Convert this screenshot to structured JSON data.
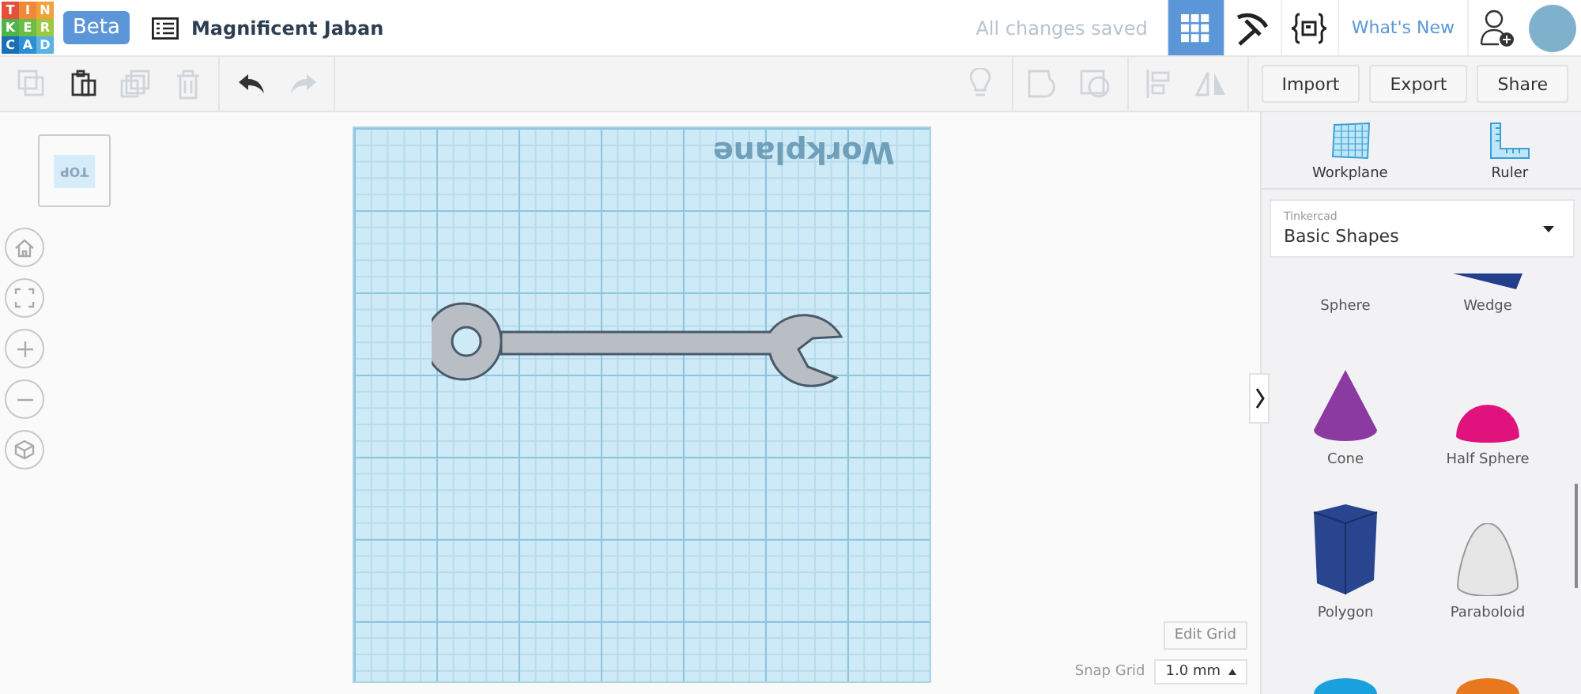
{
  "header": {
    "logo": [
      {
        "letter": "T",
        "color": "#e5503c"
      },
      {
        "letter": "I",
        "color": "#f0883a"
      },
      {
        "letter": "N",
        "color": "#f2a13c"
      },
      {
        "letter": "K",
        "color": "#4fb34a"
      },
      {
        "letter": "E",
        "color": "#6cbd45"
      },
      {
        "letter": "R",
        "color": "#9cc93d"
      },
      {
        "letter": "C",
        "color": "#1b6fb5"
      },
      {
        "letter": "A",
        "color": "#2d8fd4"
      },
      {
        "letter": "D",
        "color": "#5ab4e3"
      }
    ],
    "badge": "Beta",
    "title": "Magnificent Jaban",
    "save_status": "All changes saved",
    "nav": [
      {
        "kind": "grid",
        "selected": true
      },
      {
        "kind": "pickaxe",
        "selected": false
      },
      {
        "kind": "code",
        "selected": false
      }
    ],
    "whats_new": "What's New"
  },
  "toolbar": {
    "tools": [
      {
        "kind": "copy",
        "disabled": true
      },
      {
        "kind": "paste",
        "disabled": false
      },
      {
        "kind": "duplicate",
        "disabled": true
      },
      {
        "kind": "delete",
        "disabled": true
      },
      {
        "kind": "undo",
        "disabled": false
      },
      {
        "kind": "redo",
        "disabled": true
      }
    ],
    "view_tools": [
      {
        "kind": "bulb",
        "disabled": true
      },
      {
        "kind": "shape",
        "disabled": true
      },
      {
        "kind": "hole",
        "disabled": true
      },
      {
        "kind": "align",
        "disabled": true
      },
      {
        "kind": "mirror",
        "disabled": true
      }
    ],
    "actions": [
      "Import",
      "Export",
      "Share"
    ]
  },
  "viewcube": {
    "label": "TOP"
  },
  "view_controls": [
    {
      "kind": "home"
    },
    {
      "kind": "fit"
    },
    {
      "kind": "zoom-in"
    },
    {
      "kind": "zoom-out"
    },
    {
      "kind": "perspective"
    }
  ],
  "workplane": {
    "label": "Workplane"
  },
  "grid_controls": {
    "edit": "Edit Grid",
    "snap_label": "Snap Grid",
    "snap_value": "1.0 mm"
  },
  "panel": {
    "tools": [
      {
        "kind": "workplane",
        "label": "Workplane"
      },
      {
        "kind": "ruler",
        "label": "Ruler"
      }
    ],
    "library": {
      "caption": "Tinkercad",
      "value": "Basic Shapes"
    },
    "shapes": [
      {
        "kind": "sphere",
        "label": "Sphere"
      },
      {
        "kind": "wedge",
        "label": "Wedge",
        "color": "#233f8c"
      },
      {
        "kind": "cone",
        "label": "Cone",
        "color": "#8a3aa0"
      },
      {
        "kind": "half-sphere",
        "label": "Half Sphere",
        "color": "#e0127e"
      },
      {
        "kind": "polygon",
        "label": "Polygon",
        "color": "#2a4590"
      },
      {
        "kind": "paraboloid",
        "label": "Paraboloid",
        "color": "#e6e6e6"
      },
      {
        "kind": "round",
        "color": "#1aa0dc"
      },
      {
        "kind": "round",
        "color": "#e8781e"
      }
    ]
  }
}
